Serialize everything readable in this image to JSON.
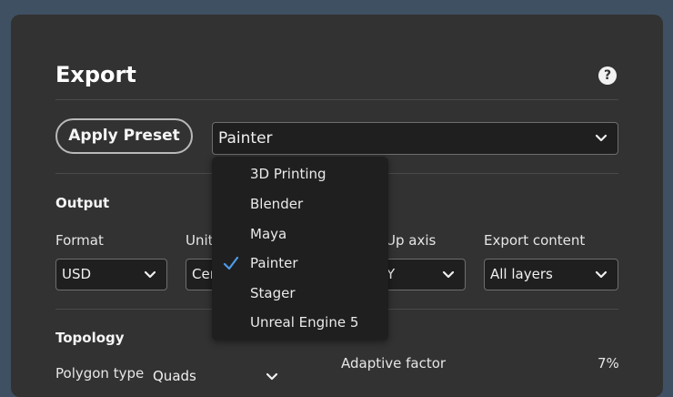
{
  "dialog": {
    "title": "Export",
    "help_icon": "?"
  },
  "preset": {
    "apply_label": "Apply Preset",
    "selected": "Painter"
  },
  "dropdown": {
    "items": [
      {
        "label": "3D Printing",
        "checked": false
      },
      {
        "label": "Blender",
        "checked": false
      },
      {
        "label": "Maya",
        "checked": false
      },
      {
        "label": "Painter",
        "checked": true
      },
      {
        "label": "Stager",
        "checked": false
      },
      {
        "label": "Unreal Engine 5",
        "checked": false
      }
    ]
  },
  "output": {
    "heading": "Output",
    "format_label": "Format",
    "format_value": "USD",
    "units_label": "Unit",
    "units_value": "Cer",
    "up_axis_label": "Up axis",
    "up_axis_value": "Y",
    "export_content_label": "Export content",
    "export_content_value": "All layers"
  },
  "topology": {
    "heading": "Topology",
    "polygon_type_label": "Polygon type",
    "polygon_type_value": "Quads",
    "adaptive_factor_label": "Adaptive factor",
    "adaptive_factor_value": "7%"
  },
  "colors": {
    "background": "#3f5062",
    "panel": "#323232",
    "field": "#1f1f1f",
    "check_accent": "#4d9be8"
  },
  "icons": [
    "help-icon",
    "chevron-down-icon",
    "checkmark-icon"
  ]
}
